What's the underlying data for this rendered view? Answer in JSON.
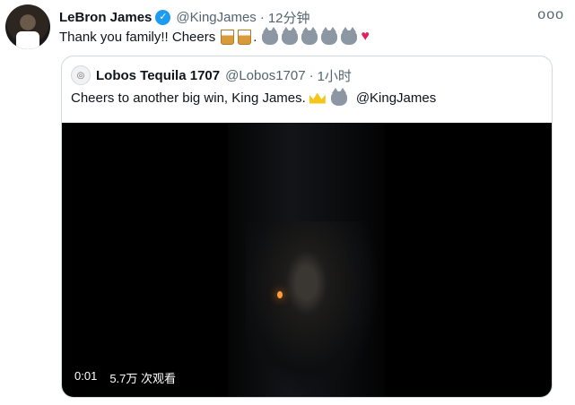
{
  "tweet": {
    "author_name": "LeBron James",
    "handle": "@KingJames",
    "separator": "·",
    "time": "12分钟",
    "text": "Thank you family!! Cheers",
    "period": ".",
    "more": "ooo"
  },
  "quoted": {
    "author_name": "Lobos Tequila 1707",
    "handle": "@Lobos1707",
    "separator": "·",
    "time": "1小时",
    "text": "Cheers to another big win, King James.",
    "mention": "@KingJames",
    "video": {
      "duration": "0:01",
      "views": "5.7万 次观看"
    }
  },
  "icons": {
    "verified": "verified-badge-icon",
    "more": "more-options-icon",
    "emoji_glass": "tumbler-glass-icon",
    "emoji_wolf": "wolf-face-icon",
    "emoji_heart": "red-heart-icon",
    "emoji_crown": "crown-icon"
  },
  "colors": {
    "accent": "#1d9bf0",
    "secondary_text": "#536471",
    "heart": "#e0245e",
    "border": "#cfd9de"
  }
}
